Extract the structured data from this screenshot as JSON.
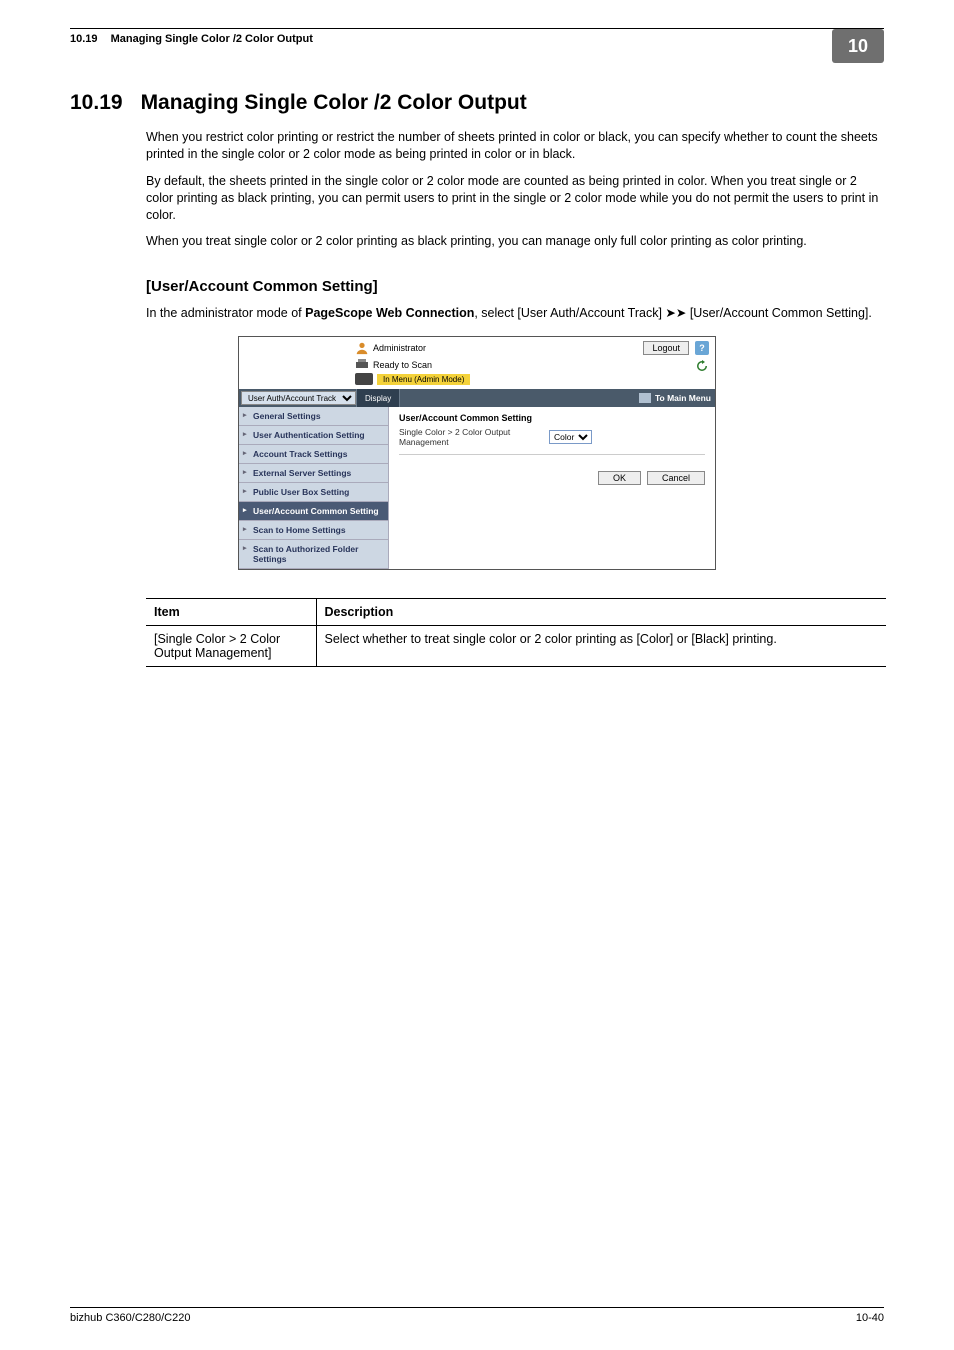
{
  "header": {
    "section_num": "10.19",
    "section_title": "Managing Single Color /2 Color Output",
    "chapter": "10"
  },
  "h1": {
    "num": "10.19",
    "title": "Managing Single Color /2 Color Output"
  },
  "paras": {
    "p1": "When you restrict color printing or restrict the number of sheets printed in color or black, you can specify whether to count the sheets printed in the single color or 2 color mode as being printed in color or in black.",
    "p2": "By default, the sheets printed in the single color or 2 color mode are counted as being printed in color. When you treat single or 2 color printing as black printing, you can permit users to print in the single or 2 color mode while you do not permit the users to print in color.",
    "p3": "When you treat single color or 2 color printing as black printing, you can manage only full color printing as color printing."
  },
  "h2": "[User/Account Common Setting]",
  "instr_prefix": "In the administrator mode of ",
  "instr_bold": "PageScope Web Connection",
  "instr_suffix": ", select [User Auth/Account Track] ➤➤ [User/Account Common Setting].",
  "shot": {
    "admin_label": "Administrator",
    "logout": "Logout",
    "help": "?",
    "ready": "Ready to Scan",
    "mode": "In Menu (Admin Mode)",
    "tab_select": "User Auth/Account Track",
    "tab_display": "Display",
    "to_main": "To Main Menu",
    "sidebar": {
      "i0": "General Settings",
      "i1": "User Authentication Setting",
      "i2": "Account Track Settings",
      "i3": "External Server Settings",
      "i4": "Public User Box Setting",
      "i5": "User/Account Common Setting",
      "i6": "Scan to Home Settings",
      "i7": "Scan to Authorized Folder Settings"
    },
    "content": {
      "title": "User/Account Common Setting",
      "row_label": "Single Color > 2 Color Output Management",
      "row_value": "Color",
      "ok": "OK",
      "cancel": "Cancel"
    }
  },
  "table": {
    "h1": "Item",
    "h2": "Description",
    "r1c1": "[Single Color > 2 Color Output Management]",
    "r1c2": "Select whether to treat single color or 2 color printing as [Color] or [Black] printing."
  },
  "footer": {
    "left": "bizhub C360/C280/C220",
    "right": "10-40"
  }
}
